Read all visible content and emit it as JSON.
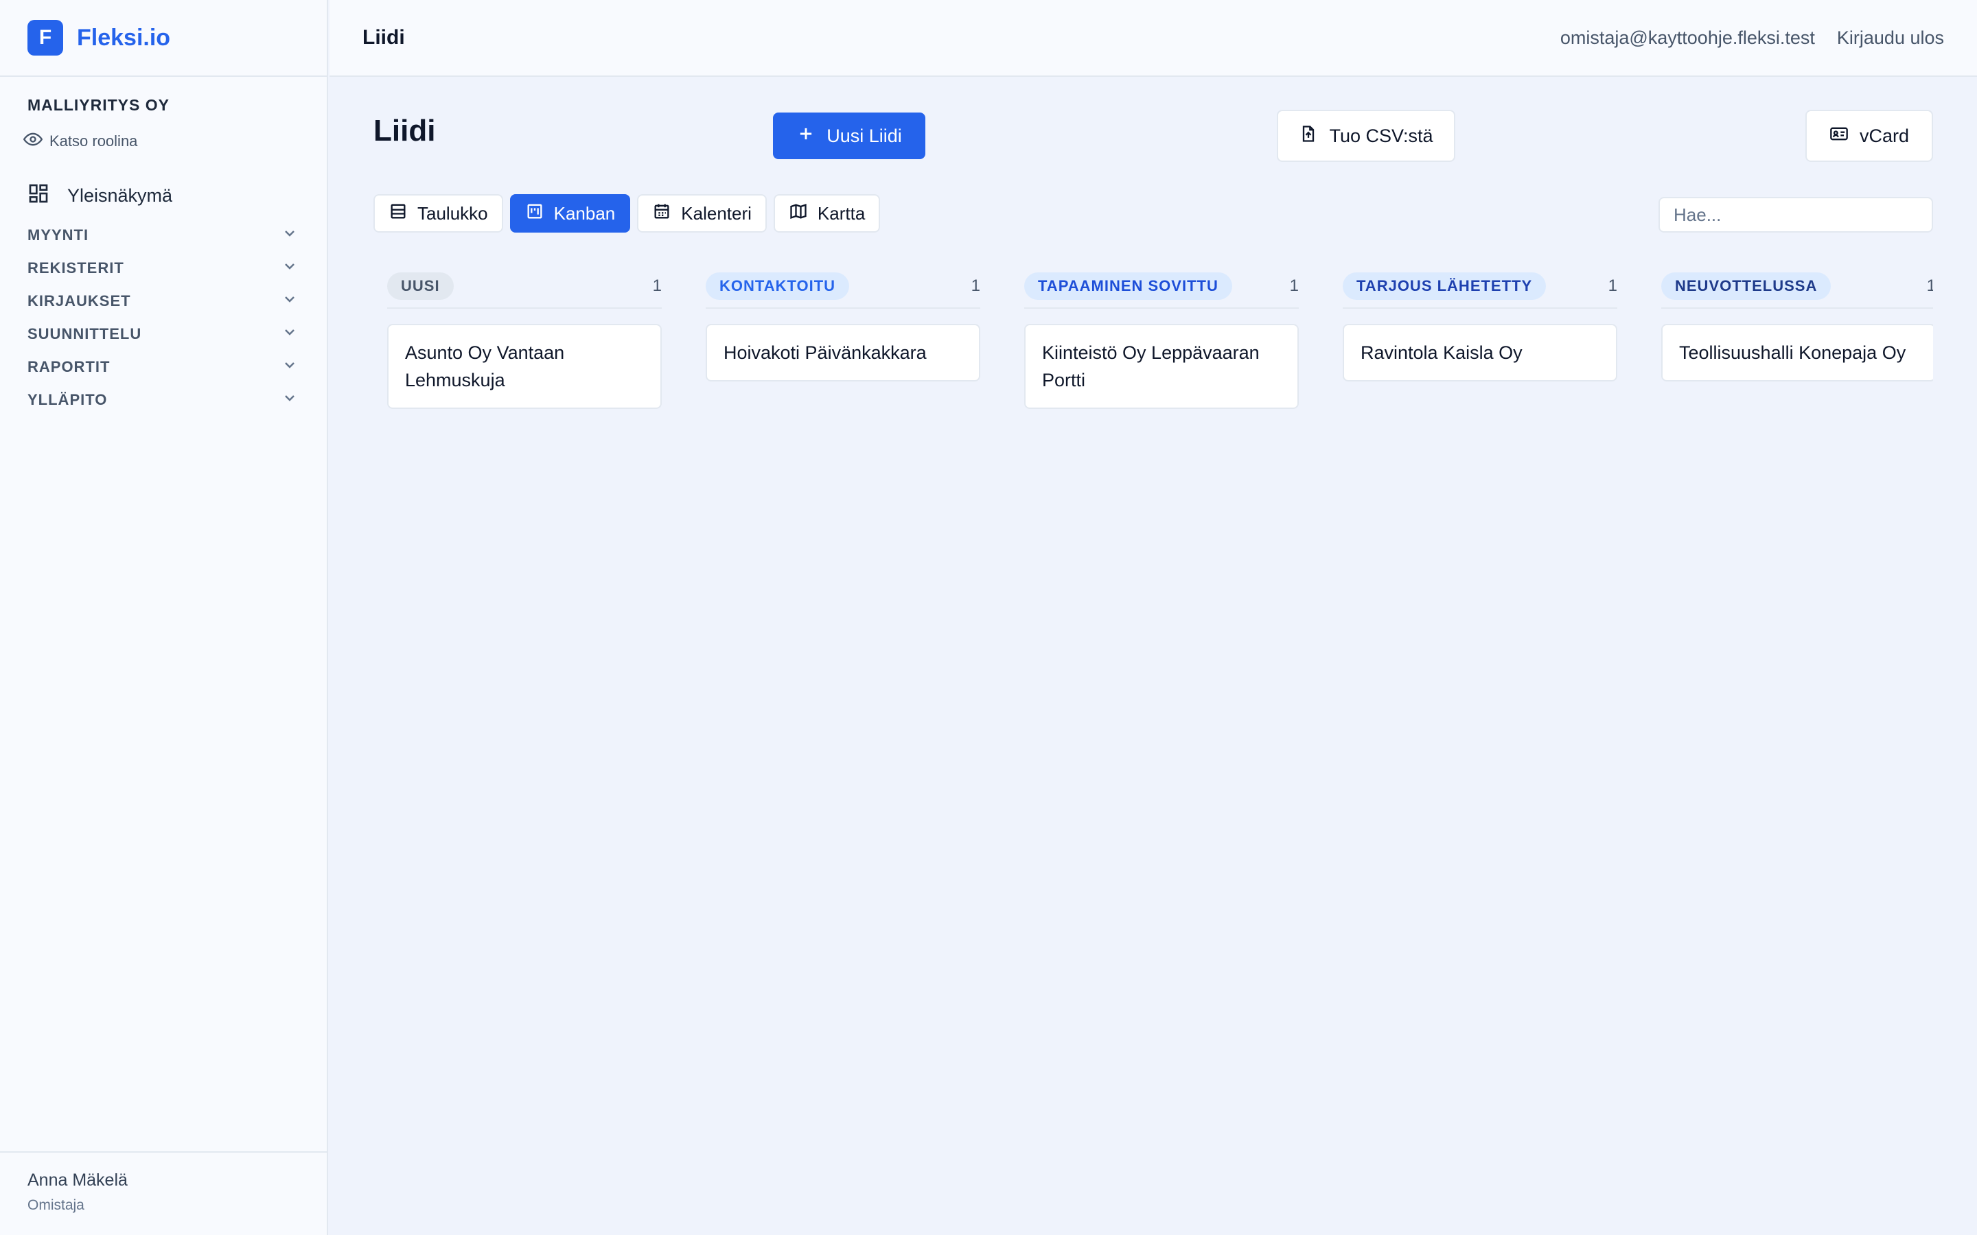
{
  "brand": {
    "logo_letter": "F",
    "name": "Fleksi.io"
  },
  "sidebar": {
    "company": "MALLIYRITYS OY",
    "view_role": "Katso roolina",
    "overview": "Yleisnäkymä",
    "groups": [
      "MYYNTI",
      "REKISTERIT",
      "KIRJAUKSET",
      "SUUNNITTELU",
      "RAPORTIT",
      "YLLÄPITO"
    ],
    "user": {
      "name": "Anna Mäkelä",
      "role": "Omistaja"
    }
  },
  "topbar": {
    "title": "Liidi",
    "email": "omistaja@kayttoohje.fleksi.test",
    "logout": "Kirjaudu ulos"
  },
  "page": {
    "title": "Liidi",
    "new_button": "Uusi Liidi",
    "csv_button": "Tuo CSV:stä",
    "vcard_button": "vCard",
    "search_placeholder": "Hae...",
    "views": [
      {
        "label": "Taulukko",
        "icon": "table-icon",
        "active": false
      },
      {
        "label": "Kanban",
        "icon": "kanban-icon",
        "active": true
      },
      {
        "label": "Kalenteri",
        "icon": "calendar-icon",
        "active": false
      },
      {
        "label": "Kartta",
        "icon": "map-icon",
        "active": false
      }
    ]
  },
  "kanban": {
    "columns": [
      {
        "title": "UUSI",
        "count": "1",
        "badge_bg": "#e2e8f0",
        "badge_fg": "#475569",
        "cards": [
          "Asunto Oy Vantaan Lehmuskuja"
        ]
      },
      {
        "title": "KONTAKTOITU",
        "count": "1",
        "badge_bg": "#dbeafe",
        "badge_fg": "#2563eb",
        "cards": [
          "Hoivakoti Päivänkakkara"
        ]
      },
      {
        "title": "TAPAAMINEN SOVITTU",
        "count": "1",
        "badge_bg": "#dbeafe",
        "badge_fg": "#1d4ed8",
        "cards": [
          "Kiinteistö Oy Leppävaaran Portti"
        ]
      },
      {
        "title": "TARJOUS LÄHETETTY",
        "count": "1",
        "badge_bg": "#dbeafe",
        "badge_fg": "#1e40af",
        "cards": [
          "Ravintola Kaisla Oy"
        ]
      },
      {
        "title": "NEUVOTTELUSSA",
        "count": "1",
        "badge_bg": "#dbeafe",
        "badge_fg": "#1e3a8a",
        "cards": [
          "Teollisuushalli Konepaja Oy"
        ]
      }
    ]
  }
}
